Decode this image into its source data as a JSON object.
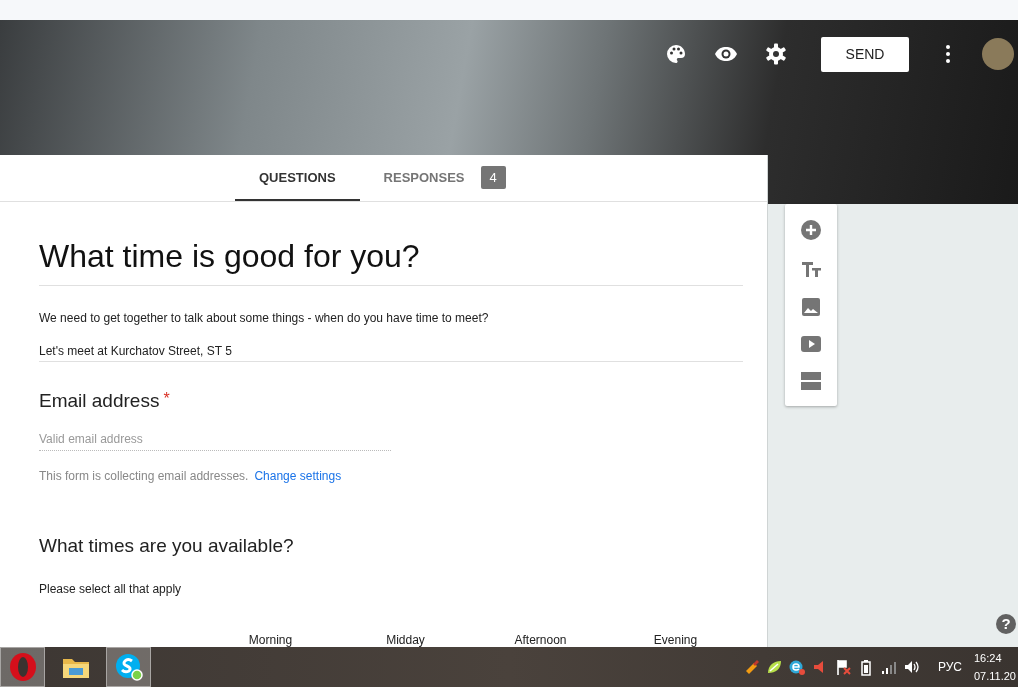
{
  "header": {
    "send_button": "SEND"
  },
  "tabs": [
    {
      "label": "QUESTIONS",
      "selected": true
    },
    {
      "label": "RESPONSES",
      "selected": false,
      "badge": "4"
    }
  ],
  "form": {
    "title": "What time is good for you?",
    "description": "We need to get together to talk about some things - when do you have time to meet?",
    "location": "Let's meet at Kurchatov Street, ST 5",
    "questions": [
      {
        "kind": "short_answer",
        "title": "Email address",
        "required_mark": "*",
        "placeholder": "Valid email address",
        "note": "This form is collecting email addresses.",
        "note_link": "Change settings"
      },
      {
        "kind": "grid",
        "title": "What times are you available?",
        "description": "Please select all that apply",
        "columns": [
          "Morning",
          "Midday",
          "Afternoon",
          "Evening"
        ]
      }
    ]
  },
  "help_button": "?",
  "taskbar": {
    "apps": [
      {
        "kind": "browser",
        "selected": true
      },
      {
        "kind": "folder",
        "selected": false
      },
      {
        "kind": "messenger",
        "selected": true
      }
    ],
    "language": "РУС",
    "time": "16:24",
    "date": "07.11.20"
  }
}
